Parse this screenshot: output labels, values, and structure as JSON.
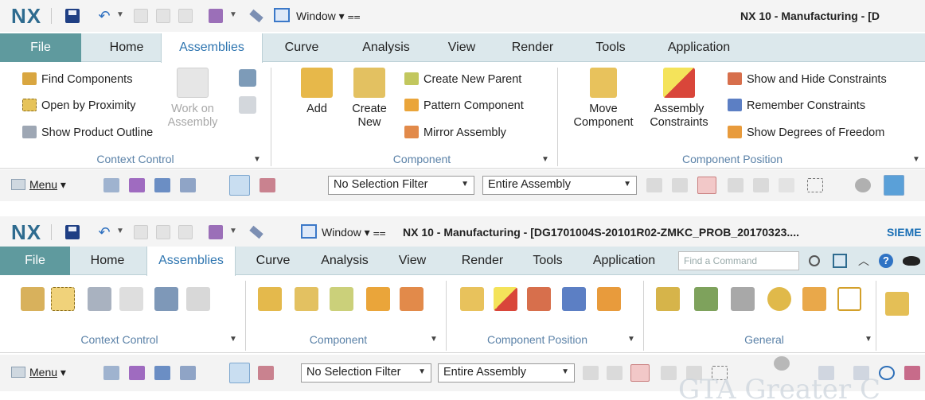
{
  "top": {
    "logo": "NX",
    "window_label": "Window",
    "title": "NX 10 - Manufacturing - [D",
    "tabs": [
      "File",
      "Home",
      "Assemblies",
      "Curve",
      "Analysis",
      "View",
      "Render",
      "Tools",
      "Application"
    ],
    "active_tab": "Assemblies",
    "context_control": {
      "items": [
        "Find Components",
        "Open by Proximity",
        "Show Product Outline"
      ],
      "work_on_assembly": "Work on Assembly",
      "label": "Context Control"
    },
    "component": {
      "add": "Add",
      "create_new": "Create New",
      "items": [
        "Create New Parent",
        "Pattern Component",
        "Mirror Assembly"
      ],
      "label": "Component"
    },
    "component_position": {
      "move_component": "Move Component",
      "assembly_constraints": "Assembly Constraints",
      "items": [
        "Show and Hide Constraints",
        "Remember Constraints",
        "Show Degrees of Freedom"
      ],
      "label": "Component Position"
    },
    "selbar": {
      "menu": "Menu",
      "filter": "No Selection Filter",
      "scope": "Entire Assembly"
    }
  },
  "bottom": {
    "logo": "NX",
    "window_label": "Window",
    "title": "NX 10 - Manufacturing - [DG1701004S-20101R02-ZMKC_PROB_20170323....",
    "brand": "SIEME",
    "tabs": [
      "File",
      "Home",
      "Assemblies",
      "Curve",
      "Analysis",
      "View",
      "Render",
      "Tools",
      "Application"
    ],
    "active_tab": "Assemblies",
    "search_placeholder": "Find a Command",
    "groups": [
      "Context Control",
      "Component",
      "Component Position",
      "General"
    ],
    "selbar": {
      "menu": "Menu",
      "filter": "No Selection Filter",
      "scope": "Entire Assembly"
    },
    "watermark": "GTA  Greater C"
  },
  "colors": {
    "file_tab": "#5f9a9e",
    "tab_bar": "#dce8ec",
    "active_tab_text": "#2e75b0",
    "group_label": "#5b82a8",
    "logo": "#2e6b8f"
  }
}
